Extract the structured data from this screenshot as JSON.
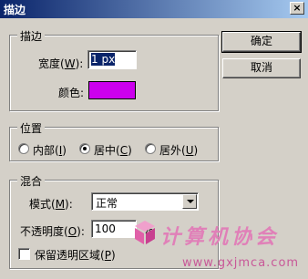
{
  "window": {
    "title": "描边",
    "close_glyph": "×"
  },
  "stroke_group": {
    "legend": "描边",
    "width_label_pre": "宽度(",
    "width_label_key": "W",
    "width_label_post": "):",
    "width_value": "1 px",
    "color_label": "颜色:",
    "color": "#cc00ee"
  },
  "position_group": {
    "legend": "位置",
    "options": [
      {
        "pre": "内部(",
        "key": "I",
        "post": ")",
        "selected": false
      },
      {
        "pre": "居中(",
        "key": "C",
        "post": ")",
        "selected": true
      },
      {
        "pre": "居外(",
        "key": "U",
        "post": ")",
        "selected": false
      }
    ]
  },
  "blend_group": {
    "legend": "混合",
    "mode_label_pre": "模式(",
    "mode_label_key": "M",
    "mode_label_post": "):",
    "mode_value": "正常",
    "opacity_label_pre": "不透明度(",
    "opacity_label_key": "O",
    "opacity_label_post": "):",
    "opacity_value": "100",
    "opacity_unit": "%",
    "preserve_pre": "保留透明区域(",
    "preserve_key": "P",
    "preserve_post": ")",
    "preserve_checked": false
  },
  "buttons": {
    "ok": "确定",
    "cancel": "取消"
  },
  "watermark": {
    "line1": "计算机协会",
    "line2": "www.gxjmca.com"
  }
}
